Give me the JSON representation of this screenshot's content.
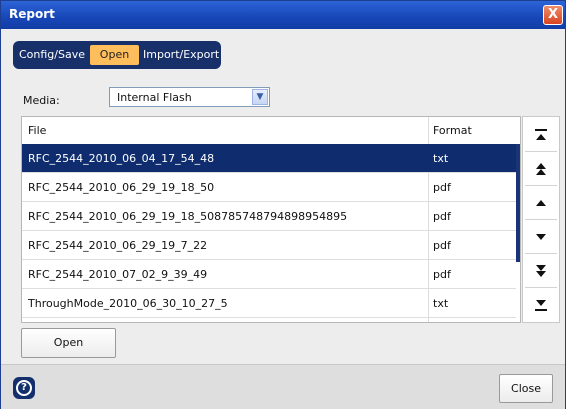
{
  "window": {
    "title": "Report"
  },
  "tabs": [
    {
      "label": "Config/Save"
    },
    {
      "label": "Open"
    },
    {
      "label": "Import/Export"
    }
  ],
  "media": {
    "label": "Media:",
    "value": "Internal Flash"
  },
  "table": {
    "columns": [
      "File",
      "Format"
    ],
    "rows": [
      {
        "file": "RFC_2544_2010_06_04_17_54_48",
        "format": "txt",
        "selected": true
      },
      {
        "file": "RFC_2544_2010_06_29_19_18_50",
        "format": "pdf"
      },
      {
        "file": "RFC_2544_2010_06_29_19_18_508785748794898954895",
        "format": "pdf"
      },
      {
        "file": "RFC_2544_2010_06_29_19_7_22",
        "format": "pdf"
      },
      {
        "file": "RFC_2544_2010_07_02_9_39_49",
        "format": "pdf"
      },
      {
        "file": "ThroughMode_2010_06_30_10_27_5",
        "format": "txt"
      }
    ]
  },
  "buttons": {
    "open": "Open",
    "close": "Close",
    "close_glyph": "X",
    "help_glyph": "?"
  },
  "icons": [
    "scroll-top-icon",
    "page-up-icon",
    "line-up-icon",
    "line-down-icon",
    "page-down-icon",
    "scroll-bottom-icon",
    "help-icon",
    "dropdown-arrow-icon"
  ],
  "colors": {
    "titlebar": "#1746b8",
    "selected_row": "#0f2d6e",
    "active_tab": "#ffbe5c",
    "tab_bar": "#17306a"
  }
}
